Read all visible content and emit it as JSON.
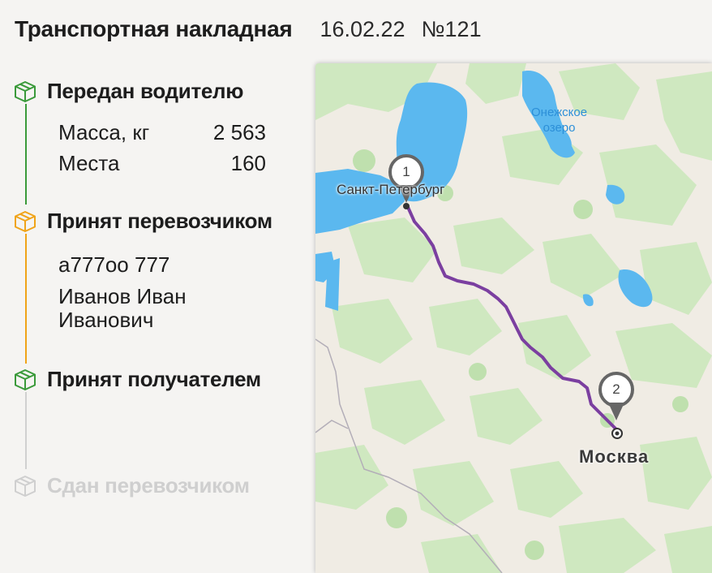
{
  "header": {
    "title": "Транспортная накладная",
    "date": "16.02.22",
    "number": "№121"
  },
  "statuses": [
    {
      "label": "Передан водителю",
      "state": "done",
      "color": "#3a9a3a"
    },
    {
      "label": "Принят перевозчиком",
      "state": "done",
      "color": "#f0a419"
    },
    {
      "label": "Принят получателем",
      "state": "current",
      "color": "#3a9a3a"
    },
    {
      "label": "Сдан перевозчиком",
      "state": "pending",
      "color": "#cfcfcf"
    }
  ],
  "cargo": {
    "mass_label": "Масса, кг",
    "mass_value": "2 563",
    "places_label": "Места",
    "places_value": "160"
  },
  "carrier": {
    "plate": "а777оо 777",
    "driver_line1": "Иванов Иван",
    "driver_line2": "Иванович"
  },
  "map": {
    "lake_label_line1": "Онежское",
    "lake_label_line2": "озеро",
    "city_from": "Санкт-Петербург",
    "city_to": "Москва",
    "marker_from": "1",
    "marker_to": "2",
    "route_color": "#7b3fa0"
  }
}
